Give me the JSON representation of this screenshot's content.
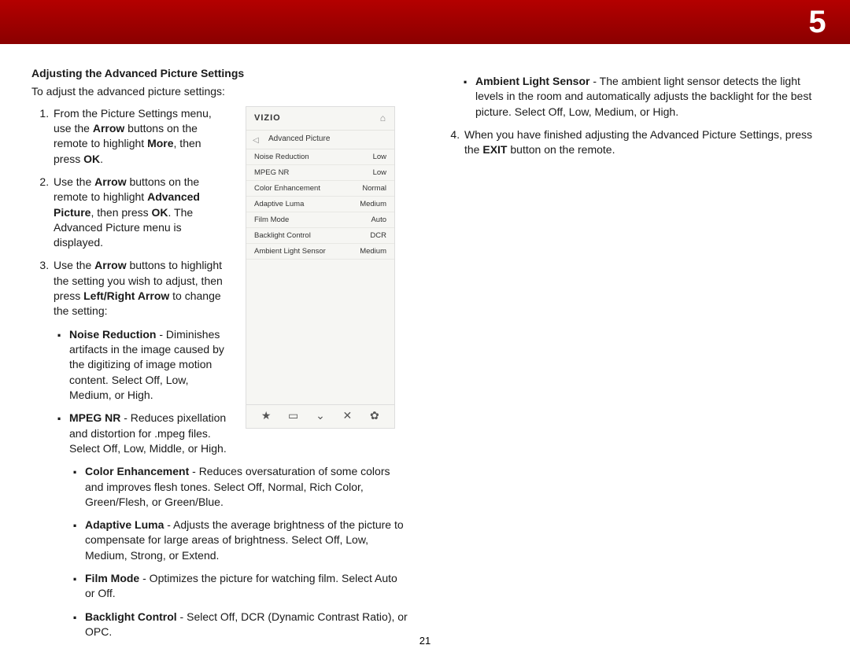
{
  "chapter_number": "5",
  "page_number": "21",
  "section_title": "Adjusting the Advanced Picture Settings",
  "intro": "To adjust the advanced picture settings:",
  "step1_a": "From the Picture Settings menu, use the ",
  "step1_b": "Arrow",
  "step1_c": " buttons on the remote to highlight ",
  "step1_d": "More",
  "step1_e": ", then press ",
  "step1_f": "OK",
  "step1_g": ".",
  "step2_a": "Use the ",
  "step2_b": "Arrow",
  "step2_c": " buttons on the remote to highlight ",
  "step2_d": "Advanced Picture",
  "step2_e": ", then press ",
  "step2_f": "OK",
  "step2_g": ". The Advanced Picture menu is displayed.",
  "step3_a": "Use the ",
  "step3_b": "Arrow",
  "step3_c": " buttons to highlight the setting you wish to adjust, then press ",
  "step3_d": "Left/Right Arrow",
  "step3_e": " to change the setting:",
  "nr_label": "Noise Reduction",
  "nr_text": " - Diminishes artifacts in the image caused by the digitizing of image motion content. Select Off, Low, Medium, or High.",
  "mpeg_label": "MPEG NR",
  "mpeg_text": " - Reduces pixellation and distortion for .mpeg files. Select Off, Low, Middle, or High.",
  "ce_label": "Color Enhancement",
  "ce_text": " - Reduces oversaturation of some colors and improves flesh tones. Select Off, Normal, Rich Color, Green/Flesh, or Green/Blue.",
  "al_label": "Adaptive Luma",
  "al_text": " - Adjusts the average brightness of the picture to compensate for large areas of brightness. Select Off, Low, Medium, Strong, or Extend.",
  "fm_label": "Film Mode",
  "fm_text": " - Optimizes the picture for watching film. Select Auto or Off.",
  "bc_label": "Backlight Control",
  "bc_text": " - Select Off, DCR (Dynamic Contrast Ratio), or OPC.",
  "als_label": "Ambient Light Sensor",
  "als_text": " - The ambient light sensor detects the light levels in the room and automatically adjusts the backlight for the best picture. Select Off, Low, Medium, or High.",
  "step4_a": "When you have finished adjusting the Advanced Picture Settings, press the ",
  "step4_b": "EXIT",
  "step4_c": " button on the remote.",
  "screenshot": {
    "brand": "VIZIO",
    "menu_title": "Advanced Picture",
    "rows": [
      {
        "label": "Noise Reduction",
        "value": "Low"
      },
      {
        "label": "MPEG NR",
        "value": "Low"
      },
      {
        "label": "Color Enhancement",
        "value": "Normal"
      },
      {
        "label": "Adaptive Luma",
        "value": "Medium"
      },
      {
        "label": "Film Mode",
        "value": "Auto"
      },
      {
        "label": "Backlight Control",
        "value": "DCR"
      },
      {
        "label": "Ambient Light Sensor",
        "value": "Medium"
      }
    ],
    "footer_icons": [
      "★",
      "▭",
      "⌄",
      "✕",
      "✿"
    ]
  }
}
